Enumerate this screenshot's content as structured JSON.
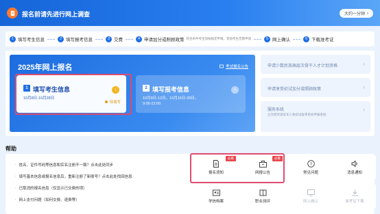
{
  "banner": {
    "title": "报名前请先进行网上调查",
    "duration": "大约一分钟"
  },
  "steps": [
    {
      "num": "1",
      "label": "填写考生信息",
      "sub": ""
    },
    {
      "num": "2",
      "label": "填写报考信息",
      "sub": ""
    },
    {
      "num": "3",
      "label": "交费",
      "sub": ""
    },
    {
      "num": "4",
      "label": "申请加分或照顾政策",
      "sub": "符合条件考生须按规定申请，其他考生无需申请"
    },
    {
      "num": "5",
      "label": "网上确认",
      "sub": ""
    },
    {
      "num": "6",
      "label": "下载准考证",
      "sub": ""
    }
  ],
  "registration": {
    "title": "2025年网上报名",
    "link": "考试报名公告",
    "card1": {
      "num": "1",
      "title": "填写考生信息",
      "date": "10月8日-10月28日",
      "status": "待填写"
    },
    "card2": {
      "num": "2",
      "title": "填写报考信息",
      "date1": "10月9日-12日，10月15日-28日，",
      "date2": "9:00-22:00"
    }
  },
  "side": [
    {
      "text": "申请少数民族高层次骨干人才计划资格",
      "sub": ""
    },
    {
      "text": "申请享受初试加分或照顾政策",
      "sub": ""
    },
    {
      "text": "服务系统",
      "sub": "立功受奖退役军人免初试复审系统申报系统"
    }
  ],
  "help": {
    "title": "帮助",
    "qa": [
      "姓名、证件号码等信息和实名注册不一致？点击此处同步",
      "填写基本信息或报名信息后，重新注册了新账号？点击此处找回信息",
      "已取消的报名信息（仅显示已交费的项）",
      "网上支付问题（如何交费、退费等）"
    ],
    "tiles": [
      {
        "label": "报名须知",
        "icon": "document-icon",
        "badge": "必看"
      },
      {
        "label": "网报公告",
        "icon": "briefcase-icon",
        "badge": "必看"
      },
      {
        "label": "常见问题",
        "icon": "question-icon",
        "badge": ""
      },
      {
        "label": "消息通知",
        "icon": "speaker-icon",
        "badge": ""
      },
      {
        "label": "学信档案",
        "icon": "id-card-icon",
        "badge": ""
      },
      {
        "label": "职业测评",
        "icon": "book-icon",
        "badge": ""
      },
      {
        "label": "网上确认",
        "icon": "monitor-icon",
        "badge": ""
      },
      {
        "label": "准考证下载",
        "icon": "download-icon",
        "badge": ""
      }
    ]
  }
}
